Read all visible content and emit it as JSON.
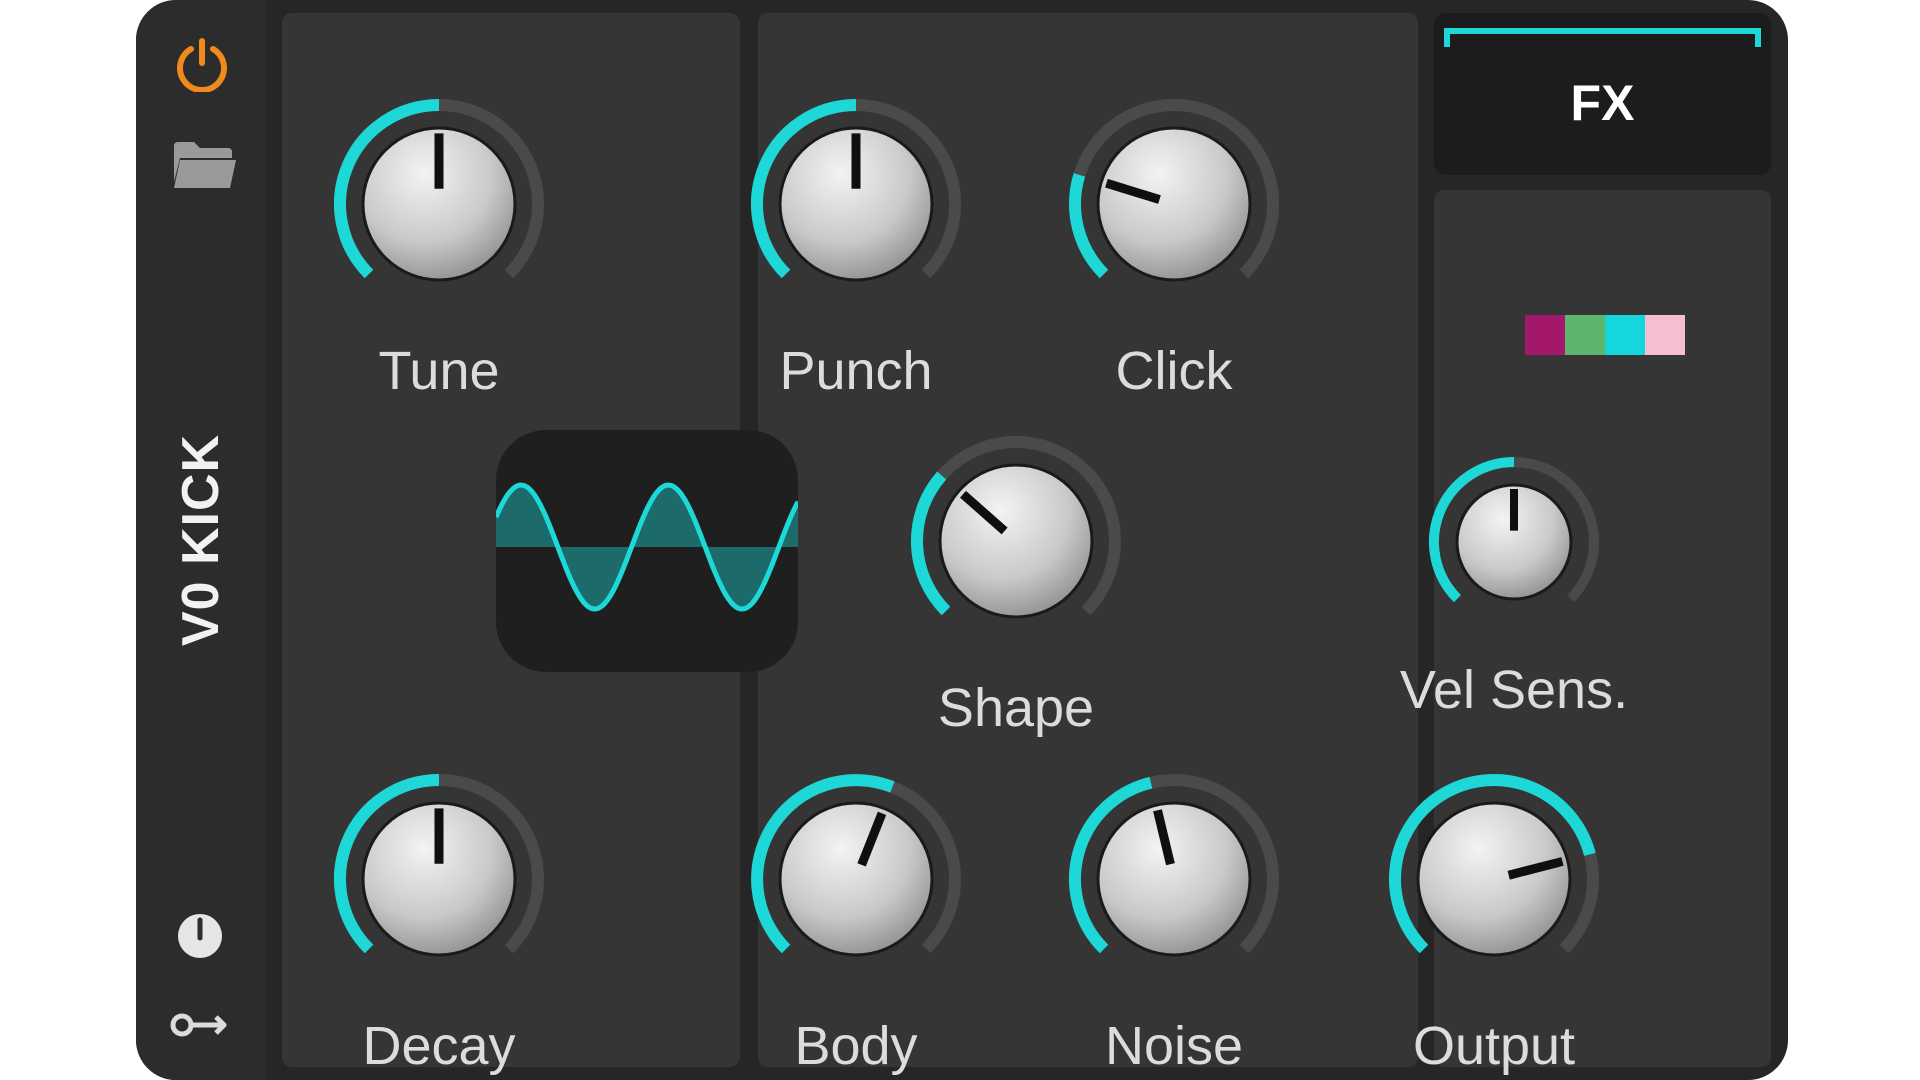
{
  "device": {
    "name": "V0 KICK",
    "fx_label": "FX"
  },
  "sidebar": {
    "icons": [
      "power-icon",
      "folder-icon",
      "clock-icon",
      "key-icon"
    ]
  },
  "colors": {
    "accent": "#1ed8d8",
    "power": "#f08a1c",
    "track": "#4a4a4a",
    "panel": "#353535"
  },
  "swatches": [
    "#a3186b",
    "#5cb56b",
    "#15d6dc",
    "#f6bfd0"
  ],
  "knobs": [
    {
      "id": "tune",
      "label": "Tune",
      "value": 0.5
    },
    {
      "id": "decay",
      "label": "Decay",
      "value": 0.5
    },
    {
      "id": "punch",
      "label": "Punch",
      "value": 0.5
    },
    {
      "id": "click",
      "label": "Click",
      "value": 0.23
    },
    {
      "id": "shape",
      "label": "Shape",
      "value": 0.32
    },
    {
      "id": "body",
      "label": "Body",
      "value": 0.58
    },
    {
      "id": "noise",
      "label": "Noise",
      "value": 0.45
    },
    {
      "id": "vel_sens",
      "label": "Vel Sens.",
      "value": 0.5
    },
    {
      "id": "output",
      "label": "Output",
      "value": 0.78
    }
  ]
}
